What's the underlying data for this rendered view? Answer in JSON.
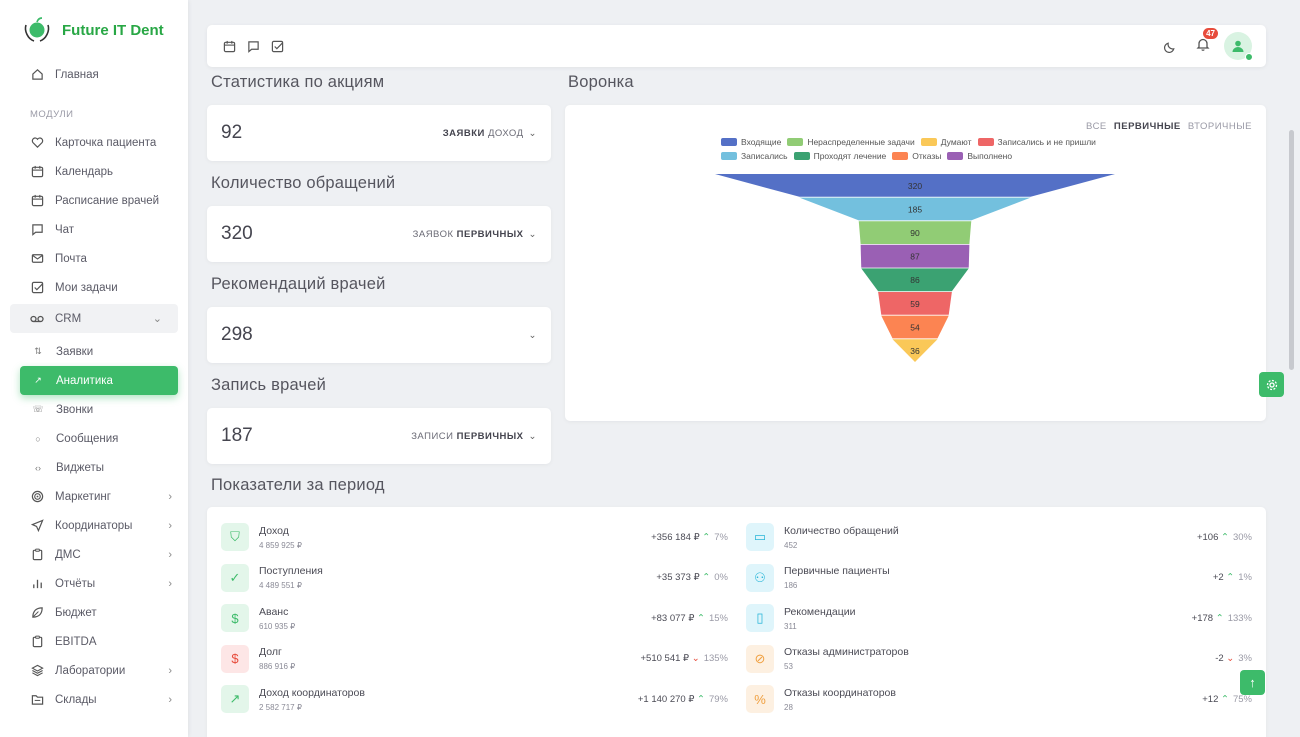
{
  "brand": {
    "name": "Future IT Dent"
  },
  "nav": {
    "home": "Главная",
    "section_modules": "МОДУЛИ",
    "items": [
      {
        "label": "Карточка пациента",
        "icon": "heart-icon"
      },
      {
        "label": "Календарь",
        "icon": "calendar-icon"
      },
      {
        "label": "Расписание врачей",
        "icon": "calendar-icon"
      },
      {
        "label": "Чат",
        "icon": "chat-icon"
      },
      {
        "label": "Почта",
        "icon": "mail-icon"
      },
      {
        "label": "Мои задачи",
        "icon": "check-square-icon"
      }
    ],
    "crm": "CRM",
    "crm_sub": [
      {
        "label": "Заявки",
        "icon": "arrows-icon"
      },
      {
        "label": "Аналитика",
        "icon": "trend-icon",
        "active": true
      },
      {
        "label": "Звонки",
        "icon": "phone-icon"
      },
      {
        "label": "Сообщения",
        "icon": "message-icon"
      },
      {
        "label": "Виджеты",
        "icon": "code-icon"
      }
    ],
    "items2": [
      {
        "label": "Маркетинг",
        "icon": "target-icon",
        "chevron": true
      },
      {
        "label": "Координаторы",
        "icon": "send-icon",
        "chevron": true
      },
      {
        "label": "ДМС",
        "icon": "clipboard-icon",
        "chevron": true
      },
      {
        "label": "Отчёты",
        "icon": "bar-chart-icon",
        "chevron": true
      },
      {
        "label": "Бюджет",
        "icon": "leaf-icon",
        "chevron": false
      },
      {
        "label": "EBITDA",
        "icon": "clipboard-icon",
        "chevron": false
      },
      {
        "label": "Лаборатории",
        "icon": "layers-icon",
        "chevron": true
      },
      {
        "label": "Склады",
        "icon": "folder-icon",
        "chevron": true
      }
    ]
  },
  "topbar": {
    "notifications": "47"
  },
  "stats": [
    {
      "title": "Статистика по акциям",
      "value": "92",
      "sel_a": "ЗАЯВКИ",
      "sel_b": "ДОХОД",
      "a_bold": true
    },
    {
      "title": "Количество обращений",
      "value": "320",
      "sel_a": "ЗАЯВОК",
      "sel_b": "ПЕРВИЧНЫХ",
      "a_bold": false
    },
    {
      "title": "Рекомендаций врачей",
      "value": "298",
      "sel_a": "",
      "sel_b": "",
      "a_bold": false
    },
    {
      "title": "Запись врачей",
      "value": "187",
      "sel_a": "ЗАПИСИ",
      "sel_b": "ПЕРВИЧНЫХ",
      "a_bold": false
    }
  ],
  "funnel": {
    "title": "Воронка",
    "filters": {
      "all": "ВСЕ",
      "primary": "ПЕРВИЧНЫЕ",
      "secondary": "ВТОРИЧНЫЕ"
    }
  },
  "chart_data": {
    "type": "funnel",
    "legend": [
      {
        "name": "Входящие",
        "color": "#5470c6"
      },
      {
        "name": "Нераспределенные задачи",
        "color": "#91cc75"
      },
      {
        "name": "Думают",
        "color": "#fac858"
      },
      {
        "name": "Записались и не пришли",
        "color": "#ee6666"
      },
      {
        "name": "Записались",
        "color": "#73c0de"
      },
      {
        "name": "Проходят лечение",
        "color": "#3ba272"
      },
      {
        "name": "Отказы",
        "color": "#fc8452"
      },
      {
        "name": "Выполнено",
        "color": "#9a60b4"
      }
    ],
    "stages": [
      {
        "value": 320,
        "color": "#5470c6"
      },
      {
        "value": 185,
        "color": "#73c0de"
      },
      {
        "value": 90,
        "color": "#91cc75"
      },
      {
        "value": 87,
        "color": "#9a60b4"
      },
      {
        "value": 86,
        "color": "#3ba272"
      },
      {
        "value": 59,
        "color": "#ee6666"
      },
      {
        "value": 54,
        "color": "#fc8452"
      },
      {
        "value": 36,
        "color": "#fac858"
      }
    ]
  },
  "period": {
    "title": "Показатели за период",
    "left": [
      {
        "label": "Доход",
        "sub": "4 859 925 ₽",
        "delta": "+356 184 ₽",
        "dir": "up",
        "pct": "7%",
        "icon": "shield-icon",
        "bg": "#e3f6ea",
        "fg": "#3dbb6a"
      },
      {
        "label": "Поступления",
        "sub": "4 489 551 ₽",
        "delta": "+35 373 ₽",
        "dir": "up",
        "pct": "0%",
        "icon": "check-icon",
        "bg": "#e3f6ea",
        "fg": "#3dbb6a"
      },
      {
        "label": "Аванс",
        "sub": "610 935 ₽",
        "delta": "+83 077 ₽",
        "dir": "up",
        "pct": "15%",
        "icon": "dollar-icon",
        "bg": "#e3f6ea",
        "fg": "#3dbb6a"
      },
      {
        "label": "Долг",
        "sub": "886 916 ₽",
        "delta": "+510 541 ₽",
        "dir": "dn",
        "pct": "135%",
        "icon": "dollar-icon",
        "bg": "#fde6e6",
        "fg": "#e74c3c"
      },
      {
        "label": "Доход координаторов",
        "sub": "2 582 717 ₽",
        "delta": "+1 140 270 ₽",
        "dir": "up",
        "pct": "79%",
        "icon": "trend-up-icon",
        "bg": "#e3f6ea",
        "fg": "#3dbb6a"
      }
    ],
    "right": [
      {
        "label": "Количество обращений",
        "sub": "452",
        "delta": "+106",
        "dir": "up",
        "pct": "30%",
        "icon": "card-icon",
        "bg": "#dff5fb",
        "fg": "#29b6d8"
      },
      {
        "label": "Первичные пациенты",
        "sub": "186",
        "delta": "+2",
        "dir": "up",
        "pct": "1%",
        "icon": "user-plus-icon",
        "bg": "#dff5fb",
        "fg": "#29b6d8"
      },
      {
        "label": "Рекомендации",
        "sub": "311",
        "delta": "+178",
        "dir": "up",
        "pct": "133%",
        "icon": "clipboard-icon",
        "bg": "#dff5fb",
        "fg": "#29b6d8"
      },
      {
        "label": "Отказы администраторов",
        "sub": "53",
        "delta": "-2",
        "dir": "dn",
        "pct": "3%",
        "icon": "eye-off-icon",
        "bg": "#fdf0e1",
        "fg": "#f0a040"
      },
      {
        "label": "Отказы координаторов",
        "sub": "28",
        "delta": "+12",
        "dir": "up",
        "pct": "75%",
        "icon": "percent-icon",
        "bg": "#fdf0e1",
        "fg": "#f0a040"
      }
    ]
  }
}
